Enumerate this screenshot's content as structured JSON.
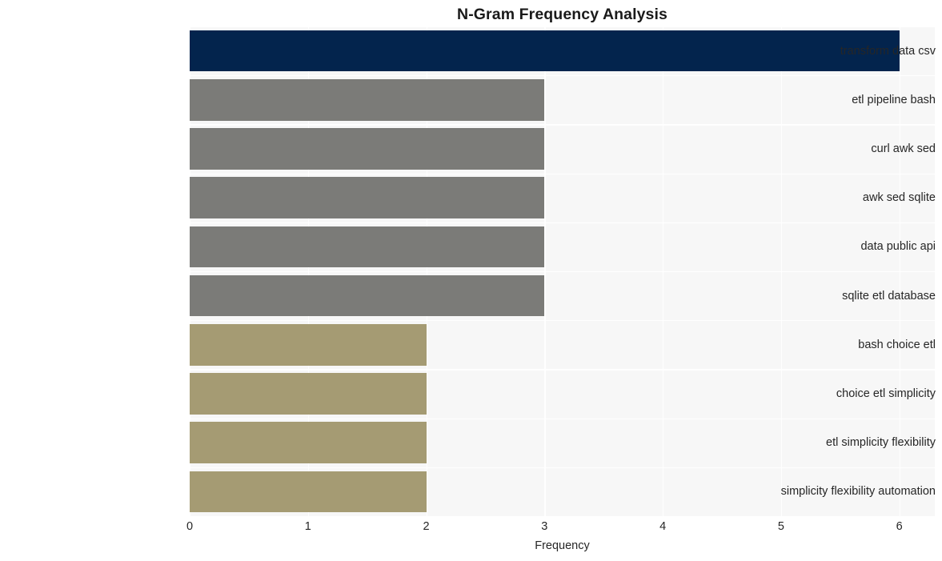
{
  "chart_data": {
    "type": "bar",
    "orientation": "horizontal",
    "title": "N-Gram Frequency Analysis",
    "xlabel": "Frequency",
    "ylabel": "",
    "xlim": [
      0,
      6.3
    ],
    "xticks": [
      "0",
      "1",
      "2",
      "3",
      "4",
      "5",
      "6"
    ],
    "xtick_values": [
      0,
      1,
      2,
      3,
      4,
      5,
      6
    ],
    "grid": true,
    "legend": null,
    "categories": [
      "transform data csv",
      "etl pipeline bash",
      "curl awk sed",
      "awk sed sqlite",
      "data public api",
      "sqlite etl database",
      "bash choice etl",
      "choice etl simplicity",
      "etl simplicity flexibility",
      "simplicity flexibility automation"
    ],
    "values": [
      6,
      3,
      3,
      3,
      3,
      3,
      2,
      2,
      2,
      2
    ],
    "bar_colors": [
      "#03244d",
      "#7b7b78",
      "#7b7b78",
      "#7b7b78",
      "#7b7b78",
      "#7b7b78",
      "#a59b73",
      "#a59b73",
      "#a59b73",
      "#a59b73"
    ],
    "palette": {
      "highlight": "#03244d",
      "mid": "#7b7b78",
      "low": "#a59b73",
      "plot_background": "#f7f7f7",
      "gridline": "#ffffff",
      "figure_background": "#ffffff",
      "text": "#262626",
      "title_text": "#1a1a1a"
    }
  }
}
